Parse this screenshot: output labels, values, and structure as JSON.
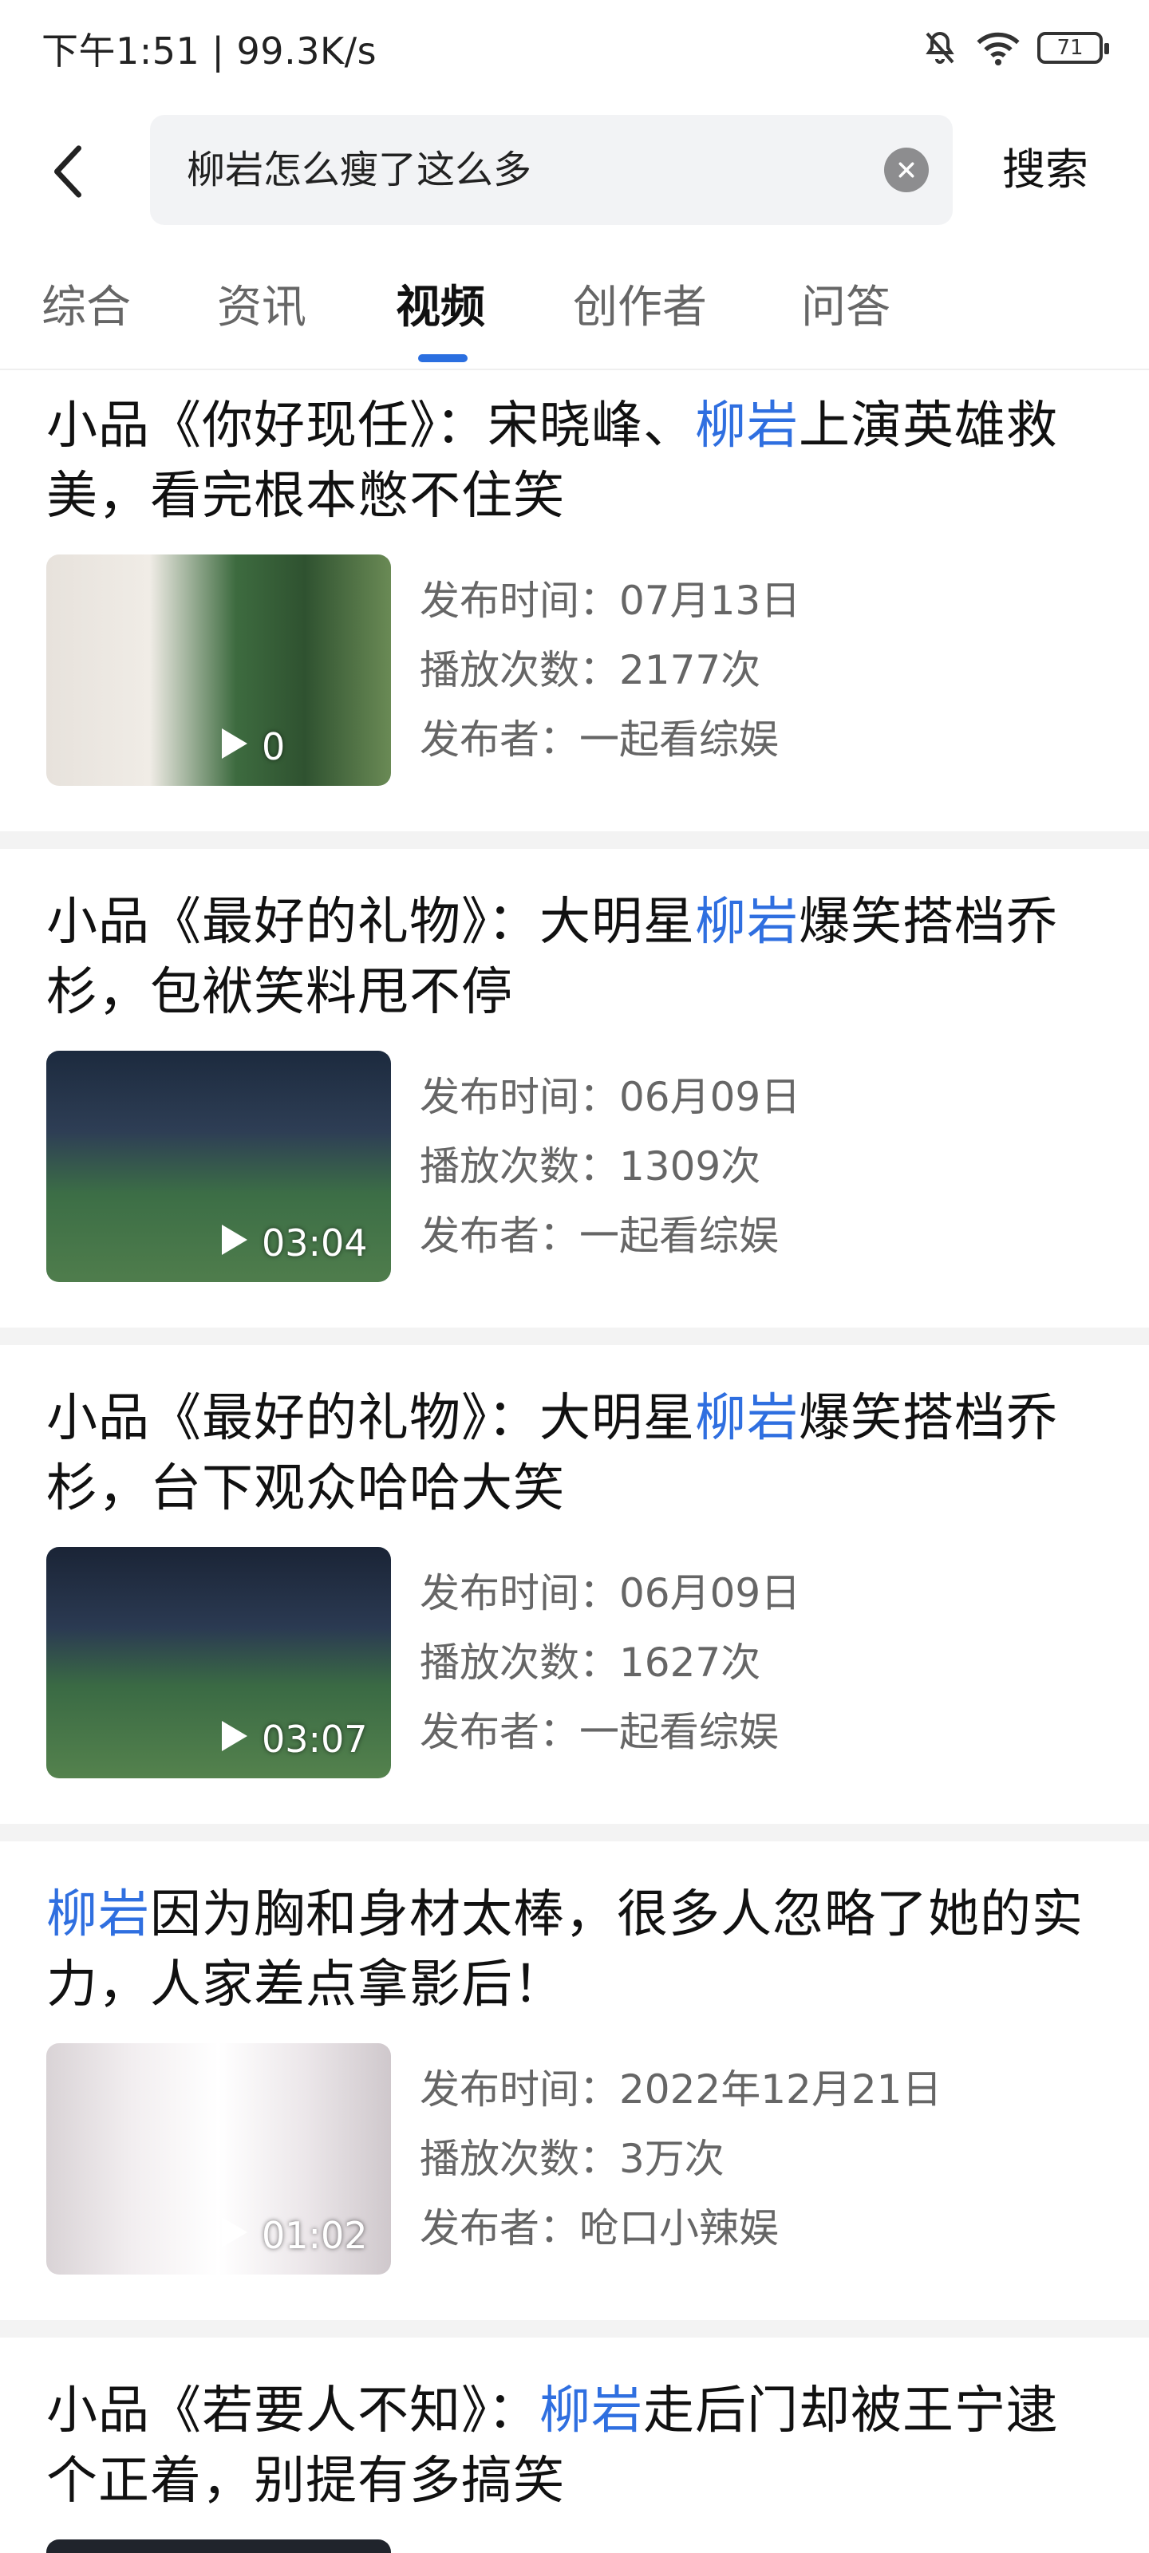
{
  "status_bar": {
    "time_speed": "下午1:51 | 99.3K/s",
    "battery": "71"
  },
  "search": {
    "query": "柳岩怎么瘦了这么多",
    "submit_label": "搜索"
  },
  "tabs": [
    {
      "label": "综合"
    },
    {
      "label": "资讯"
    },
    {
      "label": "视频"
    },
    {
      "label": "创作者"
    },
    {
      "label": "问答"
    }
  ],
  "results": [
    {
      "title_before": "小品《你好现任》：宋晓峰、",
      "title_highlight": "柳岩",
      "title_after": "上演英雄救美，看完根本憋不住笑",
      "publish_time": "发布时间：07月13日",
      "play_count": "播放次数：2177次",
      "publisher": "发布者：一起看综娱",
      "duration": "0"
    },
    {
      "title_before": "小品《最好的礼物》：大明星",
      "title_highlight": "柳岩",
      "title_after": "爆笑搭档乔杉，包袱笑料甩不停",
      "publish_time": "发布时间：06月09日",
      "play_count": "播放次数：1309次",
      "publisher": "发布者：一起看综娱",
      "duration": "03:04"
    },
    {
      "title_before": "小品《最好的礼物》：大明星",
      "title_highlight": "柳岩",
      "title_after": "爆笑搭档乔杉，台下观众哈哈大笑",
      "publish_time": "发布时间：06月09日",
      "play_count": "播放次数：1627次",
      "publisher": "发布者：一起看综娱",
      "duration": "03:07"
    },
    {
      "title_before": "",
      "title_highlight": "柳岩",
      "title_after": "因为胸和身材太棒，很多人忽略了她的实力，人家差点拿影后！",
      "publish_time": "发布时间：2022年12月21日",
      "play_count": "播放次数：3万次",
      "publisher": "发布者：呛口小辣娱",
      "duration": "01:02"
    },
    {
      "title_before": "小品《若要人不知》：",
      "title_highlight": "柳岩",
      "title_after": "走后门却被王宁逮个正着，别提有多搞笑"
    }
  ],
  "colors": {
    "highlight": "#2f6fe0",
    "tab_indicator": "#2b6fe0"
  }
}
